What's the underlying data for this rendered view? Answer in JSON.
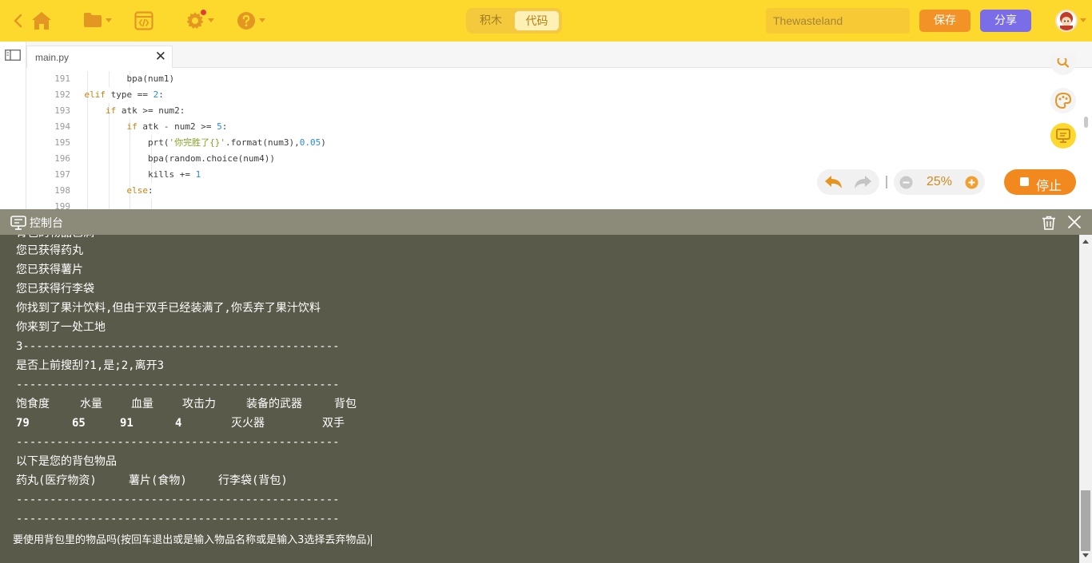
{
  "topbar": {
    "mode_blocks": "积木",
    "mode_code": "代码",
    "project_name": "Thewasteland",
    "save_label": "保存",
    "share_label": "分享"
  },
  "editor": {
    "tab_name": "main.py",
    "lines": [
      {
        "n": "191",
        "indent": 3,
        "parts": [
          {
            "t": "bpa(num1)",
            "c": ""
          }
        ]
      },
      {
        "n": "192",
        "indent": 1,
        "parts": [
          {
            "t": "elif",
            "c": "kw"
          },
          {
            "t": " type == ",
            "c": ""
          },
          {
            "t": "2",
            "c": "num"
          },
          {
            "t": ":",
            "c": ""
          }
        ]
      },
      {
        "n": "193",
        "indent": 2,
        "parts": [
          {
            "t": "if",
            "c": "kw"
          },
          {
            "t": " atk >= num2:",
            "c": ""
          }
        ]
      },
      {
        "n": "194",
        "indent": 3,
        "parts": [
          {
            "t": "if",
            "c": "kw"
          },
          {
            "t": " atk - num2 >= ",
            "c": ""
          },
          {
            "t": "5",
            "c": "num"
          },
          {
            "t": ":",
            "c": ""
          }
        ]
      },
      {
        "n": "195",
        "indent": 4,
        "parts": [
          {
            "t": "prt(",
            "c": ""
          },
          {
            "t": "'你完胜了{}'",
            "c": "str"
          },
          {
            "t": ".format(num3),",
            "c": ""
          },
          {
            "t": "0.05",
            "c": "num"
          },
          {
            "t": ")",
            "c": ""
          }
        ]
      },
      {
        "n": "196",
        "indent": 4,
        "parts": [
          {
            "t": "bpa(random.choice(num4))",
            "c": ""
          }
        ]
      },
      {
        "n": "197",
        "indent": 4,
        "parts": [
          {
            "t": "kills += ",
            "c": ""
          },
          {
            "t": "1",
            "c": "num"
          }
        ]
      },
      {
        "n": "198",
        "indent": 3,
        "parts": [
          {
            "t": "else",
            "c": "kw"
          },
          {
            "t": ":",
            "c": ""
          }
        ]
      },
      {
        "n": "199",
        "indent": 4,
        "parts": [
          {
            "t": "",
            "c": ""
          }
        ]
      }
    ],
    "zoom": "25%",
    "stop_label": "停止"
  },
  "console": {
    "title": "控制台",
    "partial_line": "背包的物品已满",
    "lines": [
      "您已获得药丸",
      "您已获得薯片",
      "您已获得行李袋",
      "你找到了果汁饮料,但由于双手已经装满了,你丢弃了果汁饮料",
      "你来到了一处工地",
      "3-----------------------------------------------",
      "是否上前搜刮?1,是;2,离开3",
      "------------------------------------------------"
    ],
    "stats_headers": [
      "饱食度",
      "水量",
      "血量",
      "攻击力",
      "装备的武器",
      "背包"
    ],
    "stats_values": [
      "79",
      "65",
      "91",
      "4",
      "灭火器",
      "双手"
    ],
    "separator": "------------------------------------------------",
    "bag_title": "以下是您的背包物品",
    "bag_items": [
      "药丸(医疗物资)",
      "薯片(食物)",
      "行李袋(背包)"
    ],
    "prompt": "要使用背包里的物品吗(按回车退出或是输入物品名称或是输入3选择丢弃物品)"
  }
}
